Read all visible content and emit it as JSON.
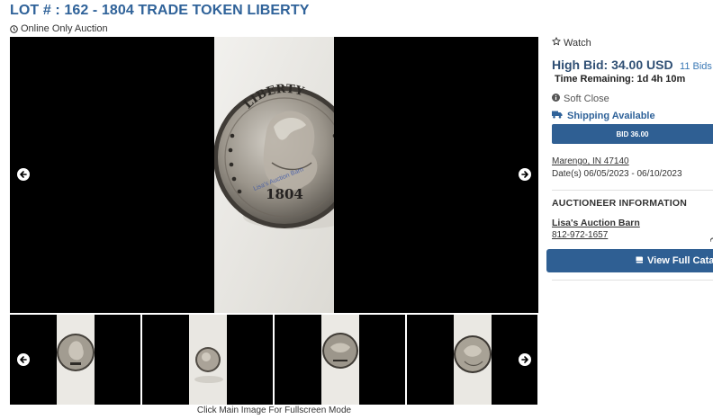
{
  "lot": {
    "title": "LOT # : 162 - 1804 TRADE TOKEN LIBERTY",
    "auction_type": "Online Only Auction"
  },
  "coin": {
    "legend": "LIBERTY",
    "year": "1804",
    "watermark": "Lisa's Auction Barn"
  },
  "gallery": {
    "caption": "Click Main Image For Fullscreen Mode"
  },
  "sidebar": {
    "watch_label": "Watch",
    "high_bid_label": "High Bid: 34.00 USD",
    "bids_label": "11 Bids",
    "time_remaining": "Time Remaining: 1d 4h 10m",
    "soft_close": "Soft Close",
    "shipping": "Shipping Available",
    "bid_button": "BID 36.00",
    "location": "Marengo, IN 47140",
    "dates": "Date(s) 06/05/2023 - 06/10/2023",
    "auctioneer_heading": "AUCTIONEER INFORMATION",
    "auctioneer_name": "Lisa's Auction Barn",
    "auctioneer_phone": "812-972-1657",
    "view_catalog": "View Full Cata"
  },
  "colors": {
    "accent": "#2f6299",
    "button": "#2f5f93",
    "link": "#3a78b5"
  }
}
